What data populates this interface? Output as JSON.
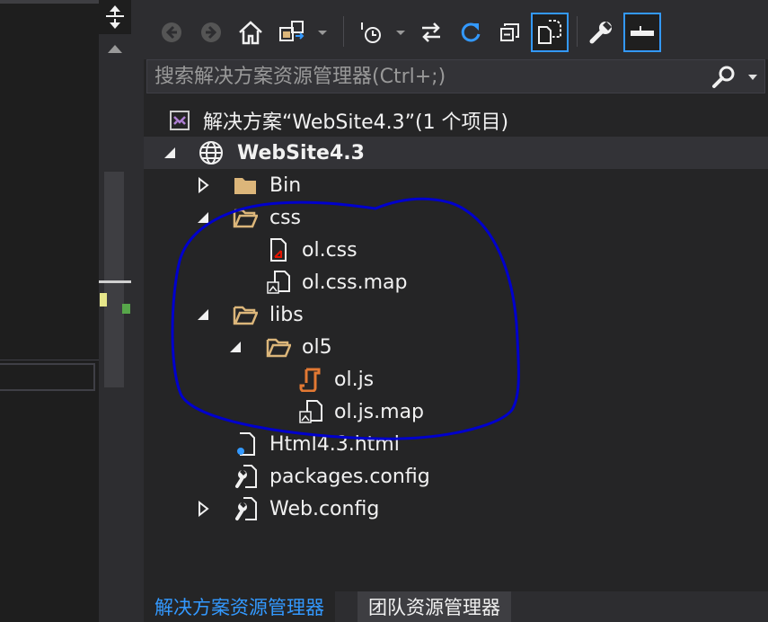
{
  "toolbar": {
    "buttons": [
      "back-icon",
      "forward-icon",
      "home-icon",
      "switch-views-icon",
      "pending-changes-filter-icon",
      "sync-icon",
      "refresh-icon",
      "collapse-all-icon",
      "show-all-files-icon",
      "properties-icon",
      "preview-icon"
    ]
  },
  "search": {
    "placeholder": "搜索解决方案资源管理器(Ctrl+;)"
  },
  "tree": {
    "solution": "解决方案“WebSite4.3”(1 个项目)",
    "project": "WebSite4.3",
    "items": [
      {
        "label": "Bin"
      },
      {
        "label": "css"
      },
      {
        "label": "ol.css"
      },
      {
        "label": "ol.css.map"
      },
      {
        "label": "libs"
      },
      {
        "label": "ol5"
      },
      {
        "label": "ol.js"
      },
      {
        "label": "ol.js.map"
      },
      {
        "label": "Html4.3.html"
      },
      {
        "label": "packages.config"
      },
      {
        "label": "Web.config"
      }
    ]
  },
  "tabs": {
    "solution_explorer": "解决方案资源管理器",
    "team_explorer": "团队资源管理器"
  },
  "colors": {
    "accent": "#3399ff",
    "panel_bg": "#252526",
    "folder": "#dcb67a",
    "js": "#e37933",
    "annotation": "#0000cc"
  }
}
